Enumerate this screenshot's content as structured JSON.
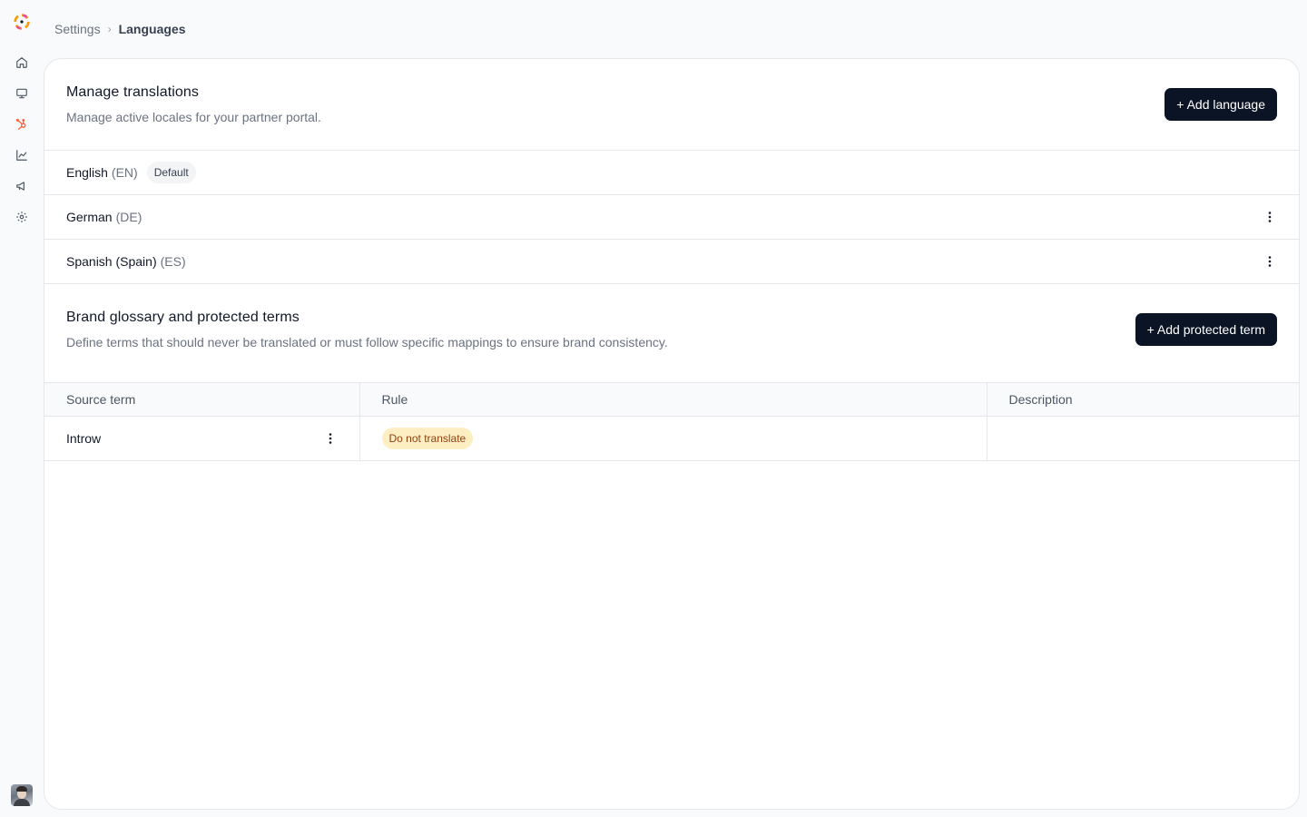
{
  "breadcrumb": {
    "parent": "Settings",
    "separator": "›",
    "current": "Languages"
  },
  "sidebar": {
    "items": [
      {
        "name": "home",
        "icon": "home-icon"
      },
      {
        "name": "monitor",
        "icon": "monitor-icon"
      },
      {
        "name": "hubspot",
        "icon": "hubspot-icon",
        "color": "#ff5c35"
      },
      {
        "name": "analytics",
        "icon": "chart-line-icon"
      },
      {
        "name": "campaigns",
        "icon": "megaphone-icon"
      },
      {
        "name": "settings",
        "icon": "gear-icon"
      }
    ]
  },
  "translations": {
    "title": "Manage translations",
    "subtitle": "Manage active locales for your partner portal.",
    "add_button": "+ Add language",
    "languages": [
      {
        "name": "English",
        "code": "(EN)",
        "badge": "Default"
      },
      {
        "name": "German",
        "code": "(DE)"
      },
      {
        "name": "Spanish (Spain)",
        "code": "(ES)"
      }
    ]
  },
  "glossary": {
    "title": "Brand glossary and protected terms",
    "subtitle": "Define terms that should never be translated or must follow specific mappings to ensure brand consistency.",
    "add_button": "+ Add protected term",
    "columns": [
      "Source term",
      "Rule",
      "Description"
    ],
    "rows": [
      {
        "source_term": "Introw",
        "rule": "Do not translate",
        "description": ""
      }
    ]
  },
  "colors": {
    "button_bg": "#0b1424",
    "rule_badge_bg": "#fdefc3",
    "rule_badge_text": "#92400e"
  }
}
